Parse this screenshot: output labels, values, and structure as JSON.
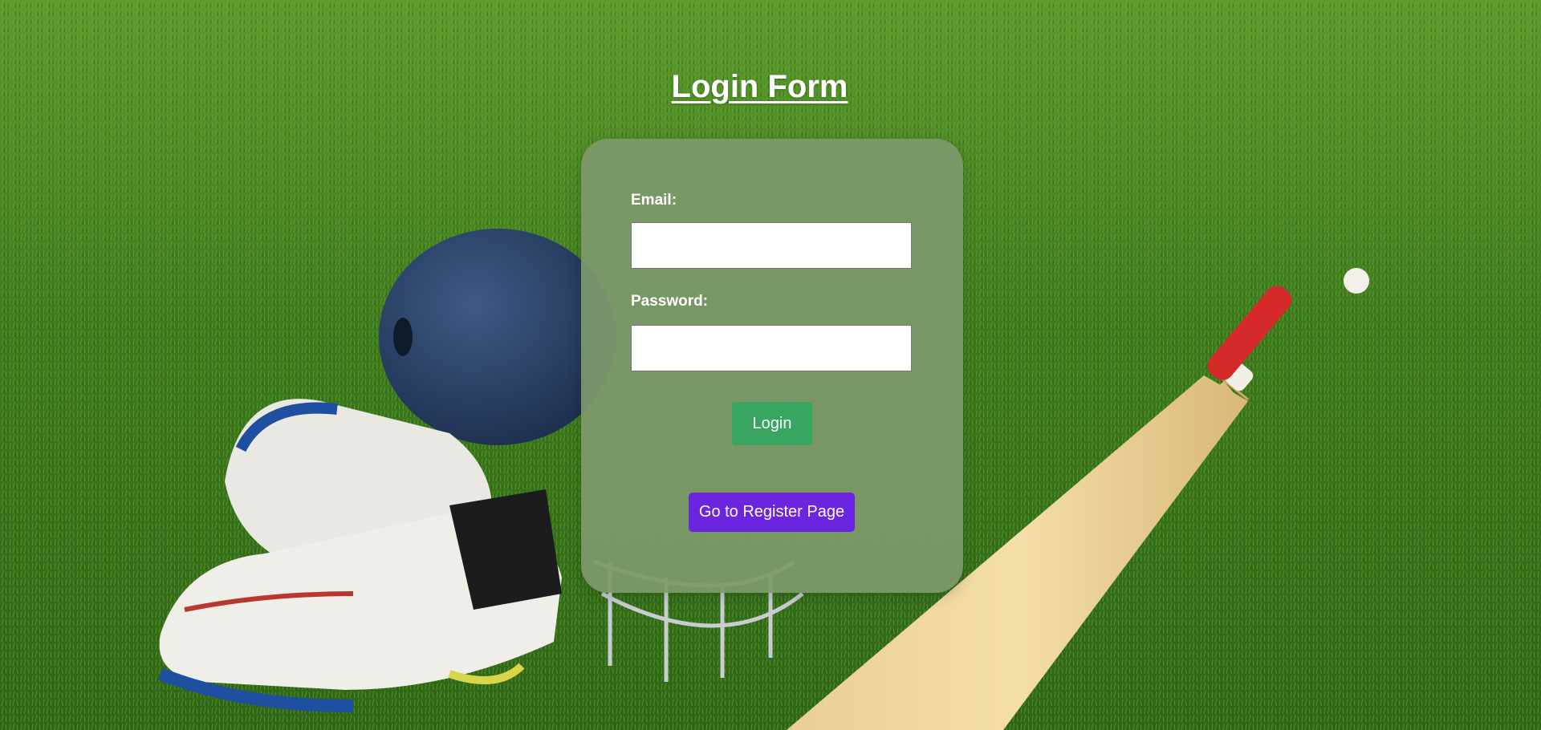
{
  "page": {
    "title": "Login Form",
    "background_image": "cricket-equipment-on-grass"
  },
  "form": {
    "email_label": "Email:",
    "email_value": "",
    "password_label": "Password:",
    "password_value": "",
    "login_label": "Login",
    "register_label": "Go to Register Page"
  },
  "colors": {
    "card": "#7e996c",
    "login_button": "#38a560",
    "register_button": "#6b25de",
    "grass": "#3f7a1f"
  }
}
